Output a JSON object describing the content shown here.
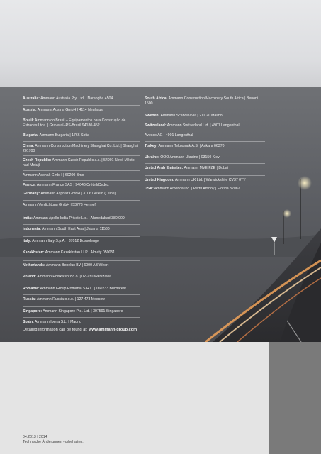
{
  "left_column": [
    {
      "country": "Australia:",
      "text": "Ammann Australia Pty. Ltd. | Narangba 4504"
    },
    {
      "country": "Austria:",
      "text": "Ammann Austria GmbH | 4114 Neuhaus"
    },
    {
      "country": "Brazil:",
      "text": "Ammann do Brasil – Equipamentos para Construção de Estradas Ltda. | Gravataí–RS-Brasil 94180-452"
    },
    {
      "country": "Bulgaria:",
      "text": "Ammann Bulgaria | 1766 Sofia"
    },
    {
      "country": "China:",
      "text": "Ammann Construction Machinery Shanghai Co. Ltd. | Shanghai 201700"
    },
    {
      "country": "Czech Republic:",
      "text": "Ammann Czech Republic a.s. | 54901 Nové Město nad Metují"
    },
    {
      "country": "",
      "text": "Ammann Asphalt GmbH | 60200 Brno"
    },
    {
      "country": "France:",
      "text": "Ammann France SAS | 94046 Créteil/Cedex"
    },
    {
      "country": "Germany:",
      "text": "Ammann Asphalt GmbH | 31061 Alfeld (Leine)"
    },
    {
      "country": "",
      "text": "Ammann Verdichtung GmbH | 53773 Hennef"
    },
    {
      "country": "India:",
      "text": "Ammann Apollo India Private Ltd. | Ahmedabad 380 009"
    },
    {
      "country": "Indonesia:",
      "text": "Ammann South East Asia | Jakarta 11530"
    },
    {
      "country": "Italy:",
      "text": "Ammann Italy S.p.A. | 37012 Bussolengo"
    },
    {
      "country": "Kazakhstan:",
      "text": "Ammann Kazakhstan LLP | Almaty 050051"
    },
    {
      "country": "Netherlands:",
      "text": "Ammann Benelux BV | 6000 AB Weert"
    },
    {
      "country": "Poland:",
      "text": "Ammann Polska sp.z.o.o. | 02-230 Warszawa"
    },
    {
      "country": "Romania:",
      "text": "Ammann Group Romania S.R.L. | 060233 Bucharest"
    },
    {
      "country": "Russia:",
      "text": "Ammann Russia o.o.o. | 127 473 Moscow"
    },
    {
      "country": "Singapore:",
      "text": "Ammann Singapore Pte. Ltd. | 307591 Singapore"
    },
    {
      "country": "Spain:",
      "text": "Ammann Iberia S.L. | Madrid"
    }
  ],
  "right_column": [
    {
      "country": "South Africa:",
      "text": "Ammann Construction Machinery South Africa | Benoni 1500"
    },
    {
      "country": "Sweden:",
      "text": "Ammann Scandinavia | 211 20 Malmö"
    },
    {
      "country": "Switzerland:",
      "text": "Ammann Switzerland Ltd. | 4901 Langenthal"
    },
    {
      "country": "",
      "text": "Avesco AG | 4901 Langenthal"
    },
    {
      "country": "Turkey:",
      "text": "Ammann Teknomak A.S. | Ankara 06370"
    },
    {
      "country": "Ukraine:",
      "text": "OOO Ammann Ukraine | 03150 Kiev"
    },
    {
      "country": "United Arab Emirates:",
      "text": "Ammann MVE FZE | Dubai"
    },
    {
      "country": "United Kingdom:",
      "text": "Ammann UK Ltd. | Warwickshire CV37 0TY"
    },
    {
      "country": "USA:",
      "text": "Ammann America Inc. | Perth Amboy | Florida 32082"
    }
  ],
  "footer": {
    "info_prefix": "Detailed information can be found at: ",
    "info_link": "www.ammann-group.com"
  },
  "meta": {
    "code": "04.2013 | 2014",
    "note": "Technische Änderungen vorbehalten."
  }
}
